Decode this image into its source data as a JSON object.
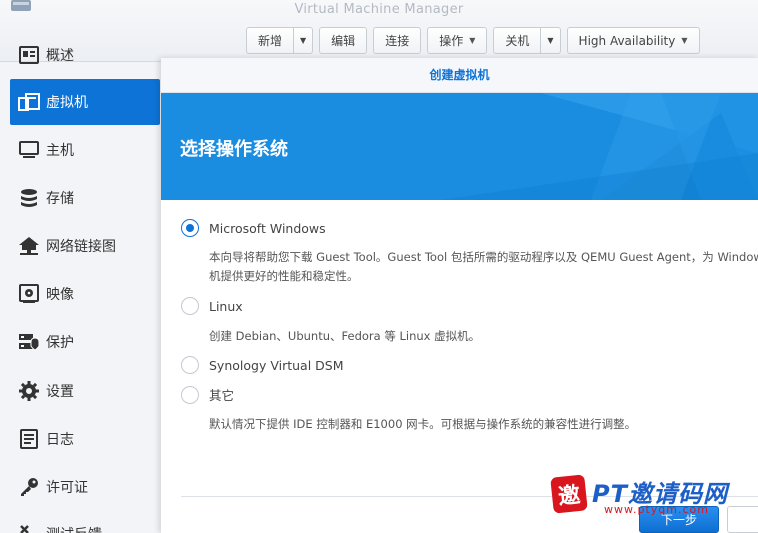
{
  "app": {
    "title": "Virtual Machine Manager"
  },
  "toolbar": {
    "buttons": [
      {
        "label": "新增"
      },
      {
        "label": "编辑"
      },
      {
        "label": "连接"
      },
      {
        "label": "操作"
      },
      {
        "label": "关机"
      },
      {
        "label": "High Availability"
      }
    ]
  },
  "sidebar": {
    "items": [
      {
        "label": "概述",
        "icon": "overview-icon"
      },
      {
        "label": "虚拟机",
        "icon": "virtual-machine-icon",
        "active": true
      },
      {
        "label": "主机",
        "icon": "monitor-icon"
      },
      {
        "label": "存储",
        "icon": "storage-icon"
      },
      {
        "label": "网络链接图",
        "icon": "network-icon"
      },
      {
        "label": "映像",
        "icon": "image-icon"
      },
      {
        "label": "保护",
        "icon": "protection-icon"
      },
      {
        "label": "设置",
        "icon": "gear-icon"
      },
      {
        "label": "日志",
        "icon": "log-icon"
      },
      {
        "label": "许可证",
        "icon": "key-icon"
      },
      {
        "label": "测试反馈",
        "icon": "feedback-icon"
      }
    ]
  },
  "dialog": {
    "title": "创建虚拟机",
    "banner_title": "选择操作系统",
    "accent": "#0d73d7",
    "options": [
      {
        "label": "Microsoft Windows",
        "checked": true,
        "desc": [
          "本向导将帮助您下载 Guest Tool。Guest Tool 包括所需的驱动程序以及 QEMU Guest Agent，为 Windows",
          "机提供更好的性能和稳定性。"
        ]
      },
      {
        "label": "Linux",
        "checked": false,
        "desc": [
          "创建 Debian、Ubuntu、Fedora 等 Linux 虚拟机。"
        ]
      },
      {
        "label": "Synology Virtual DSM",
        "checked": false,
        "desc": []
      },
      {
        "label": "其它",
        "checked": false,
        "desc": [
          "默认情况下提供 IDE 控制器和 E1000 网卡。可根据与操作系统的兼容性进行调整。"
        ]
      }
    ],
    "next_label": "下一步"
  },
  "watermark": {
    "logo_char": "邀",
    "text": "PT邀请码网",
    "url": "www.ptyqm.com"
  }
}
